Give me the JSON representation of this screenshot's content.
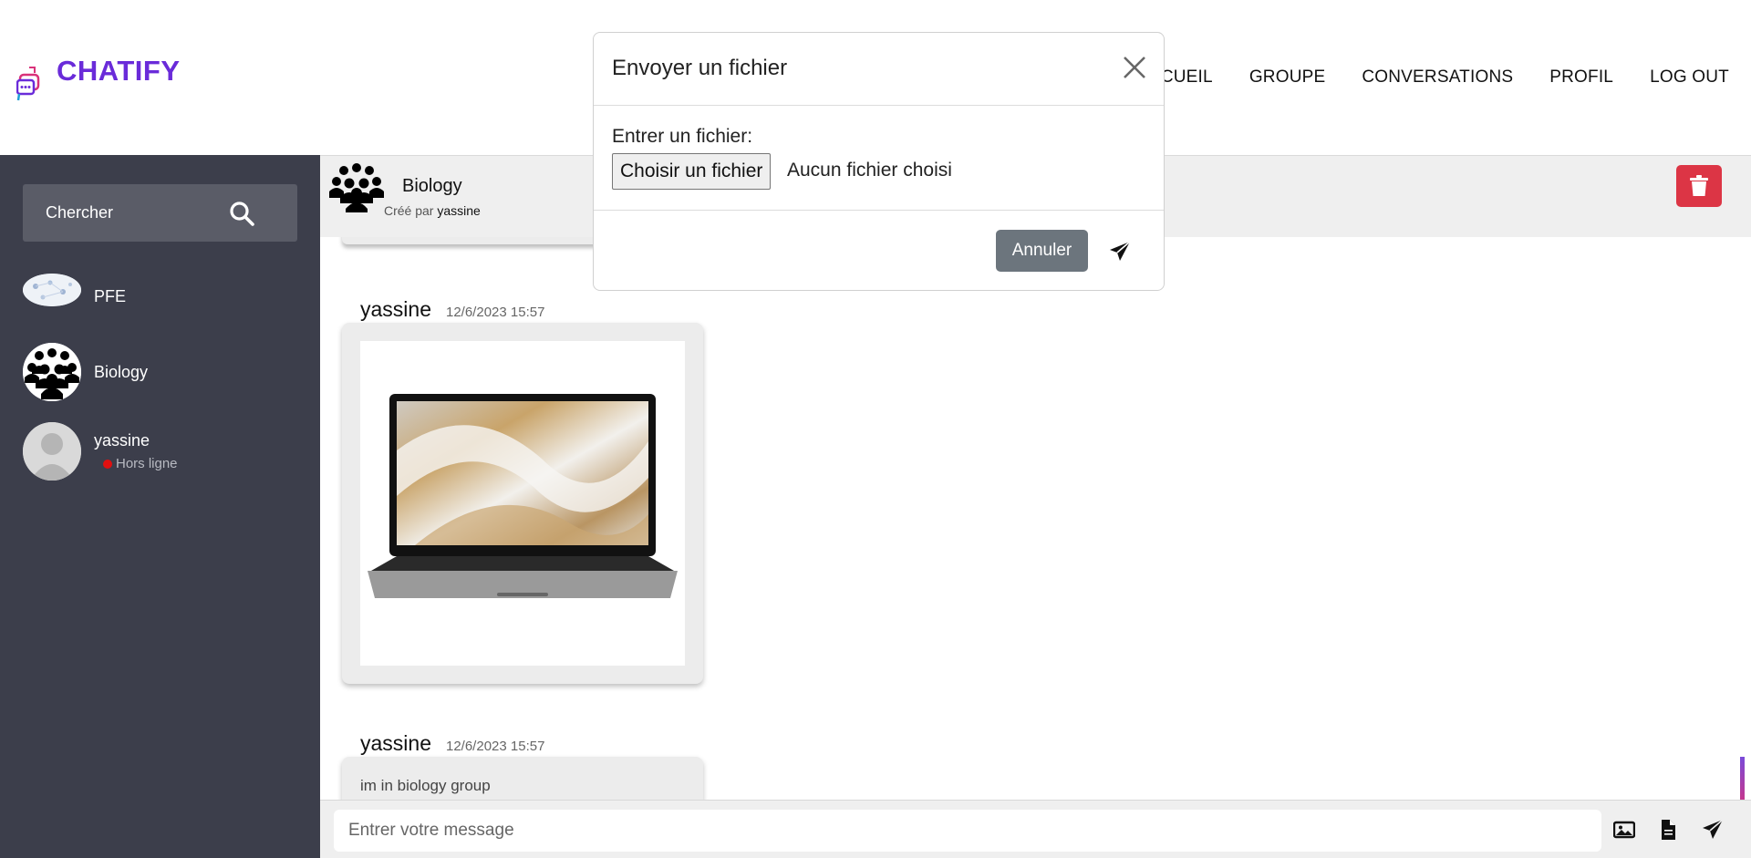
{
  "app": {
    "name": "CHATIFY"
  },
  "nav": {
    "items": [
      "ACCUEIL",
      "GROUPE",
      "CONVERSATIONS",
      "PROFIL",
      "LOG OUT"
    ]
  },
  "sidebar": {
    "search_placeholder": "Chercher",
    "contacts": [
      {
        "name": "PFE"
      },
      {
        "name": "Biology"
      },
      {
        "name": "yassine",
        "status": "Hors ligne"
      }
    ]
  },
  "chat": {
    "title": "Biology",
    "created_by_prefix": "Créé par",
    "created_by": "yassine",
    "messages": [
      {
        "sender": "yassine",
        "time": "12/6/2023 15:57",
        "kind": "image"
      },
      {
        "sender": "yassine",
        "time": "12/6/2023 15:57",
        "kind": "text",
        "text": "im in biology group"
      }
    ]
  },
  "composer": {
    "placeholder": "Entrer votre message"
  },
  "modal": {
    "title": "Envoyer un fichier",
    "label": "Entrer un fichier:",
    "choose_button": "Choisir un fichier",
    "no_file": "Aucun fichier choisi",
    "cancel": "Annuler"
  },
  "colors": {
    "brand": "#6a2bd9",
    "sidebar": "#3c3e4b",
    "danger": "#dc3545",
    "secondary": "#6c757d",
    "offline": "#e01010"
  }
}
